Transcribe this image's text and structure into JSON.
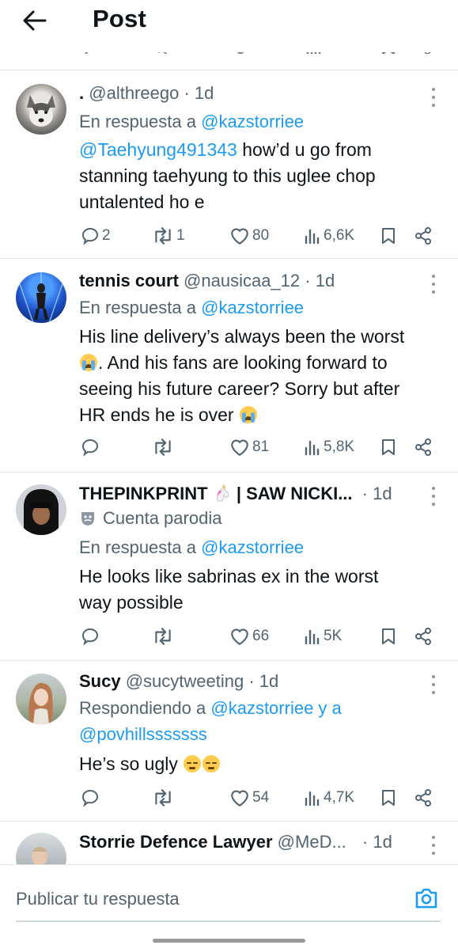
{
  "header": {
    "title": "Post"
  },
  "reply_bar": {
    "placeholder": "Publicar tu respuesta"
  },
  "tweets": [
    {
      "name": ".",
      "handle": "@althreego",
      "time": "· 1d",
      "reply_prefix": "En respuesta a",
      "reply_to": "@kazstorriee",
      "mention": "@Taehyung491343",
      "body_line1": " how’d u go from",
      "body_line2": "stanning taehyung to this uglee chop",
      "body_line3": "untalented ho e",
      "replies": "2",
      "reposts": "1",
      "likes": "80",
      "views": "6,6K"
    },
    {
      "name": "tennis court",
      "handle": "@nausicaa_12",
      "time": "· 1d",
      "reply_prefix": "En respuesta a",
      "reply_to": "@kazstorriee",
      "body_line1": "His line delivery’s always been the worst",
      "body_line2": ". And his fans are looking forward to",
      "body_line3": "seeing his future career? Sorry but after",
      "body_line4": "HR ends he is over ",
      "replies": "",
      "reposts": "",
      "likes": "81",
      "views": "5,8K"
    },
    {
      "name": "THEPINKPRINT",
      "name_suffix": " | SAW NICKI...",
      "time": "· 1d",
      "parody_label": "Cuenta parodia",
      "reply_prefix": "En respuesta a",
      "reply_to": "@kazstorriee",
      "body_line1": "He looks like sabrinas ex in the worst",
      "body_line2": "way possible",
      "replies": "",
      "reposts": "",
      "likes": "66",
      "views": "5K"
    },
    {
      "name": "Sucy",
      "handle": "@sucytweeting",
      "time": "· 1d",
      "reply_prefix": "Respondiendo a",
      "reply_to": "@kazstorriee y a",
      "reply_to2": "@povhillsssssss",
      "body_line1": "He’s so ugly ",
      "replies": "",
      "reposts": "",
      "likes": "54",
      "views": "4,7K"
    },
    {
      "name": "Storrie Defence Lawyer",
      "handle": "@MeD...",
      "time": "· 1d"
    }
  ],
  "icons": {
    "back": "arrow-left-icon",
    "reply": "chat-bubble-icon",
    "repost": "repost-arrows-icon",
    "like": "heart-icon",
    "views": "bar-chart-icon",
    "bookmark": "bookmark-icon",
    "share": "share-icon",
    "more": "more-vertical-icon",
    "camera": "camera-icon",
    "parody": "theater-mask-icon",
    "emoji_cry": "loudly-crying-face",
    "emoji_pensive": "pensive-face",
    "emoji_unicorn": "unicorn-face"
  },
  "colors": {
    "link": "#1d9bf0",
    "secondary": "#536471",
    "text": "#0f1419",
    "divider": "#e1e6ea"
  }
}
